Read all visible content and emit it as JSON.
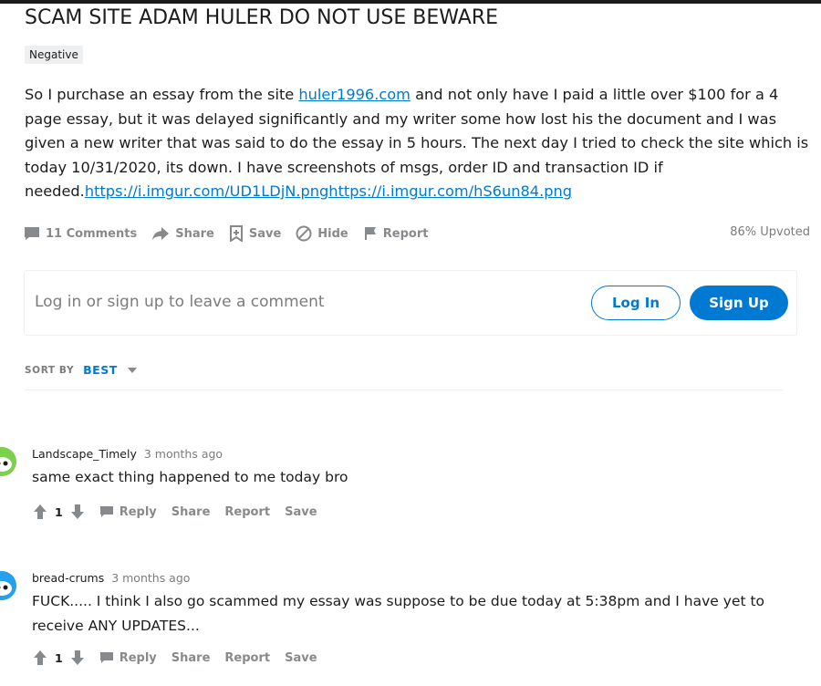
{
  "post": {
    "title": "SCAM SITE ADAM HULER DO NOT USE BEWARE",
    "flair": "Negative",
    "body_part1": "So I purchase an essay from the site ",
    "body_link": "huler1996.com",
    "body_part2": " and not only have I paid a little over $100 for a 4 page essay, but it was delayed significantly and my writer some how lost his the document and I was given a new writer that was said to do the essay in 5 hours. The next day I tried to check the site which is today 10/31/2020, its down. I have screenshots of msgs, order ID and transaction ID if needed.",
    "body_urls": "https://i.imgur.com/UD1LDjN.pnghttps://i.imgur.com/hS6un84.png",
    "actions": {
      "comments": "11 Comments",
      "share": "Share",
      "save": "Save",
      "hide": "Hide",
      "report": "Report"
    },
    "upvoted": "86% Upvoted"
  },
  "comment_box": {
    "prompt": "Log in or sign up to leave a comment",
    "login_label": "Log In",
    "signup_label": "Sign Up"
  },
  "sort": {
    "label": "SORT BY",
    "value": "BEST"
  },
  "comments": [
    {
      "author": "Landscape_Timely",
      "time": "3 months ago",
      "text": "same exact thing happened to me today bro",
      "votes": "1",
      "reply": "Reply",
      "share": "Share",
      "report": "Report",
      "save": "Save",
      "avatar_color": "#7bd04c"
    },
    {
      "author": "bread-crums",
      "time": "3 months ago",
      "text": "FUCK..... I think I also go scammed my essay was suppose to be due today at 5:38pm and I have yet to receive ANY UPDATES...",
      "votes": "1",
      "reply": "Reply",
      "share": "Share",
      "report": "Report",
      "save": "Save",
      "avatar_color": "#24a0ed"
    }
  ],
  "colors": {
    "accent": "#0079d3",
    "muted": "#878a8c"
  }
}
